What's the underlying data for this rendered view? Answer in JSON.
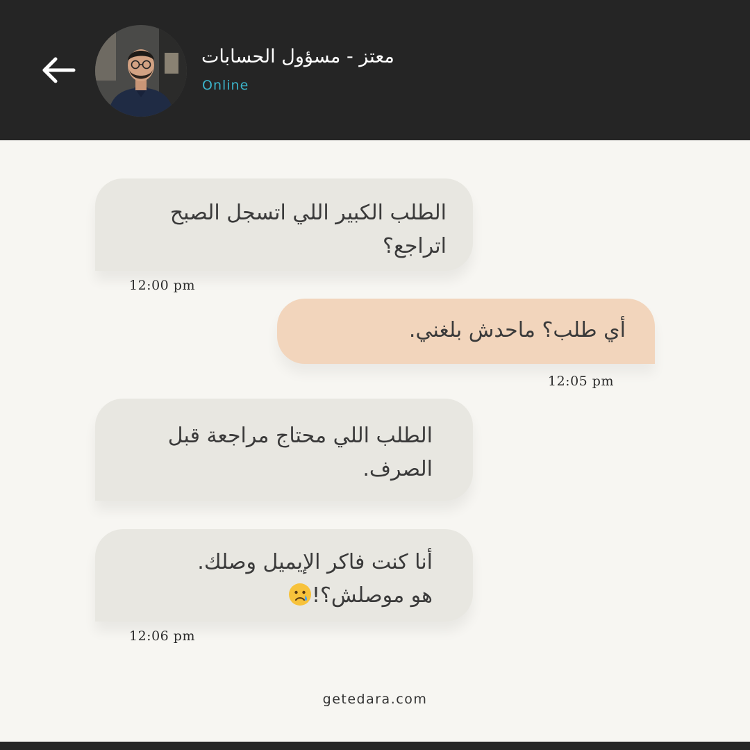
{
  "header": {
    "contact_name": "معتز - مسؤول الحسابات",
    "status": "Online",
    "back_icon": "arrow-left-icon",
    "avatar_icon": "contact-avatar"
  },
  "messages": [
    {
      "direction": "received",
      "text_line1": "الطلب الكبير اللي اتسجل الصبح",
      "text_line2": "اتراجع؟",
      "time": "12:00 pm"
    },
    {
      "direction": "sent",
      "text_line1": "أي طلب؟ ماحدش بلغني.",
      "time": "12:05 pm"
    },
    {
      "direction": "received",
      "text_line1": "الطلب اللي محتاج مراجعة قبل",
      "text_line2": "الصرف.",
      "time": ""
    },
    {
      "direction": "received",
      "text_line1": "أنا كنت فاكر الإيميل وصلك.",
      "text_line2": "هو موصلش؟!",
      "emoji": "😢",
      "time": "12:06 pm"
    }
  ],
  "footer": {
    "website": "getedara.com"
  },
  "colors": {
    "header_bg": "#252525",
    "page_bg": "#f7f6f2",
    "received_bubble": "#e8e7e1",
    "sent_bubble": "#f2d5bc",
    "status_color": "#3bb3c9"
  }
}
